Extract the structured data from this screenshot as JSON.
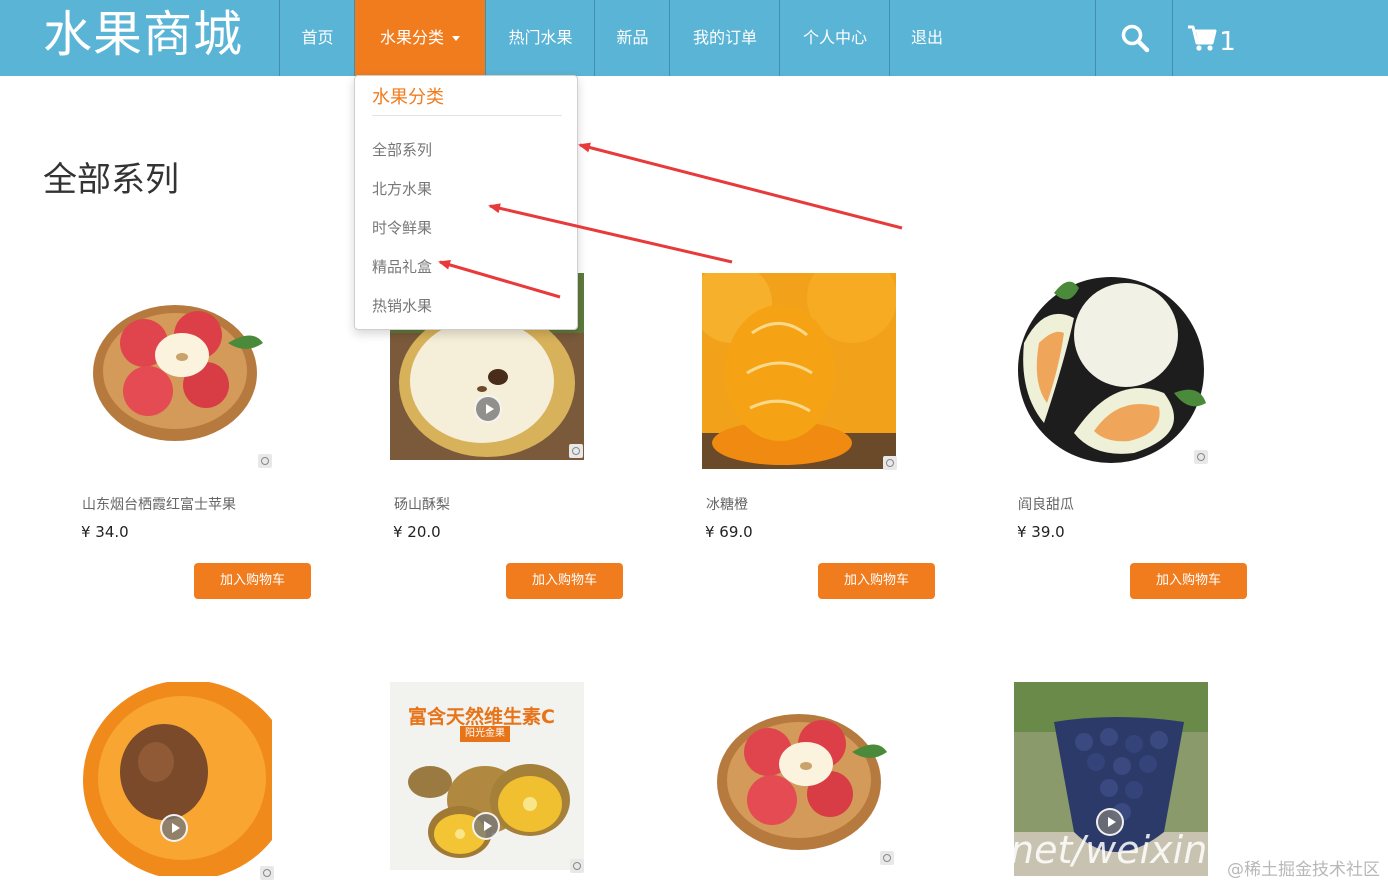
{
  "header": {
    "brand": "水果商城",
    "nav": [
      {
        "label": "首页"
      },
      {
        "label": "水果分类"
      },
      {
        "label": "热门水果"
      },
      {
        "label": "新品"
      },
      {
        "label": "我的订单"
      },
      {
        "label": "个人中心"
      },
      {
        "label": "退出"
      }
    ],
    "search_icon": "search-icon",
    "cart_icon": "cart-icon",
    "cart_count": "1",
    "colors": {
      "bar": "#5ab4d6",
      "active": "#f07c1e"
    }
  },
  "dropdown": {
    "header": "水果分类",
    "items": [
      {
        "label": "全部系列"
      },
      {
        "label": "北方水果"
      },
      {
        "label": "时令鲜果"
      },
      {
        "label": "精品礼盒"
      },
      {
        "label": "热销水果"
      }
    ]
  },
  "section_title": "全部系列",
  "products": [
    {
      "name": "山东烟台栖霞红富士苹果",
      "price": "¥ 34.0",
      "button": "加入购物车",
      "image": "apple-basket"
    },
    {
      "name": "砀山酥梨",
      "price": "¥ 20.0",
      "button": "加入购物车",
      "image": "pear"
    },
    {
      "name": "冰糖橙",
      "price": "¥ 69.0",
      "button": "加入购物车",
      "image": "orange"
    },
    {
      "name": "阎良甜瓜",
      "price": "¥ 39.0",
      "button": "加入购物车",
      "image": "melon"
    }
  ],
  "products_row2": [
    {
      "image": "apricot"
    },
    {
      "image": "kiwi",
      "banner": "富含天然维生素C",
      "tag": "阳光金果"
    },
    {
      "image": "apple-basket"
    },
    {
      "image": "grapes"
    }
  ],
  "overlay_text": "net/weixin",
  "watermark": "@稀土掘金技术社区"
}
